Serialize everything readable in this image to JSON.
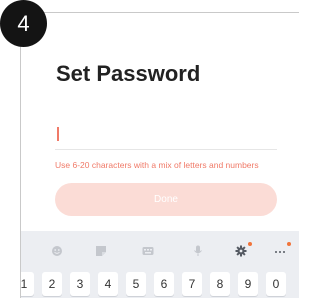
{
  "step_badge": "4",
  "screen": {
    "title": "Set Password",
    "password_field": {
      "value": "",
      "placeholder": ""
    },
    "hint": "Use 6-20 characters with a mix of letters and numbers",
    "done_label": "Done"
  },
  "keyboard": {
    "toolbar_icons": [
      "emoji-icon",
      "sticker-icon",
      "keyboard-layout-icon",
      "microphone-icon",
      "settings-icon",
      "more-icon"
    ],
    "number_keys": [
      "1",
      "2",
      "3",
      "4",
      "5",
      "6",
      "7",
      "8",
      "9",
      "0"
    ]
  },
  "colors": {
    "accent": "#f07a68",
    "button_disabled": "#fbdcd6",
    "keyboard_bg": "#eceef2",
    "badge_bg": "#141414"
  }
}
